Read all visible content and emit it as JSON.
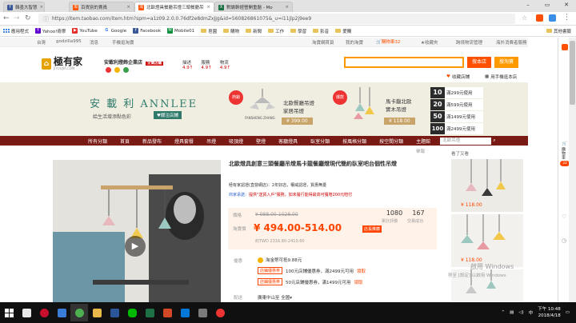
{
  "tabs": [
    {
      "label": "韓墨大智慧",
      "icon": "facebook-icon",
      "color": "#3b5998"
    },
    {
      "label": "百貨別的賣員",
      "icon": "taobao-icon",
      "color": "#ff5000"
    },
    {
      "label": "北歐燈具餐廳吊燈三頭餐廳吊燈",
      "icon": "taobao-icon",
      "color": "#ff5000"
    },
    {
      "label": "對論幹經營開重題 - Mo",
      "icon": "excel-icon",
      "color": "#1e7145"
    }
  ],
  "address": {
    "url": "https://item.taobao.com/item.htm?spm=a1z09.2.0.0.76df2e8dmZxJjg&id=560826861075&_u=i11jlp2j9ee9"
  },
  "bookmarks": [
    {
      "label": "應用程式",
      "icon": "apps-icon"
    },
    {
      "label": "Yahoo!奇摩",
      "icon": "yahoo-icon"
    },
    {
      "label": "YouTube",
      "icon": "youtube-icon"
    },
    {
      "label": "Google",
      "icon": "google-icon"
    },
    {
      "label": "Facebook",
      "icon": "facebook-icon"
    },
    {
      "label": "Mobile01",
      "icon": "mobile01-icon"
    },
    {
      "label": "皂園",
      "icon": "folder-icon"
    },
    {
      "label": "購物",
      "icon": "folder-icon"
    },
    {
      "label": "新聞",
      "icon": "folder-icon"
    },
    {
      "label": "工作",
      "icon": "folder-icon"
    },
    {
      "label": "學習",
      "icon": "folder-icon"
    },
    {
      "label": "影音",
      "icon": "folder-icon"
    },
    {
      "label": "愛購",
      "icon": "folder-icon"
    }
  ],
  "bookmarks_other": "其他書籤",
  "tb_top": {
    "region": "台灣",
    "user": "godzilla995",
    "msg": "消息",
    "mobile": "手機逛淘寶",
    "links": [
      "淘寶網首頁",
      "我的淘寶",
      "購物車32",
      "收藏夾",
      "商品分類",
      "免費開店",
      "賣家中心",
      "聯繫客服",
      "網站導航"
    ],
    "cart": "購物車32",
    "fav": "收藏夾",
    "seller": "跨境物流管理",
    "extra": "海外消費者服務"
  },
  "shop": {
    "logo": "極有家",
    "logo_sub": "JIYOUJIA.COM",
    "name": "安載利燈飾企業店",
    "badge": "企業店鋪",
    "ratings": [
      {
        "label": "描述",
        "value": "4.9"
      },
      {
        "label": "服務",
        "value": "4.9"
      },
      {
        "label": "物流",
        "value": "4.9"
      }
    ],
    "search_btn1": "搜本店",
    "search_btn2": "搜淘寶",
    "hot": "收藏店鋪",
    "mobile_shop": "用手機逛本店"
  },
  "banner": {
    "brand": "安 載 利 ANNLEE",
    "slogan": "給生活增添點色彩",
    "follow": "♥關注店鋪",
    "promo1": {
      "tag": "熱銷",
      "title": "北歐餐廳吊燈",
      "sub": "家居吊燈",
      "price": "¥ 399.00",
      "brandname": "FANSHENG ZHANG"
    },
    "promo2": {
      "tag": "爆款",
      "title": "馬卡龍北歐",
      "sub": "實木吊燈",
      "price": "¥ 118.00"
    },
    "coupons": [
      {
        "amount": "10",
        "desc": "滿299元使用"
      },
      {
        "amount": "20",
        "desc": "滿599元使用"
      },
      {
        "amount": "50",
        "desc": "滿1499元使用"
      },
      {
        "amount": "100",
        "desc": "滿2499元使用"
      }
    ]
  },
  "nav": [
    "所有分類",
    "首頁",
    "新品發布",
    "燈具套餐",
    "吊燈",
    "吸頂燈",
    "壁燈",
    "落地燈",
    "客廳燈具",
    "臥室分類",
    "客廳吊燈",
    "按風格分類",
    "按空間分類",
    "主題館"
  ],
  "nav_search_placeholder": "北歐吊燈",
  "product": {
    "title": "北歐燈具創意三頭餐廳吊燈馬卡龍餐廳燈現代簡約臥室吧台個性吊燈",
    "report": "舉報",
    "promo_line": "極有家認證(直營網店)：2年好店，權威認證，質惠無憂",
    "notice_label": "商家承諾：",
    "notice": "提供\"送貨入戶\"服務，如未履行能得最高可獲賠200元賠付",
    "price_label": "價格",
    "orig_price": "¥ 988.00-1028.00",
    "promo_label": "淘寶價",
    "price": "¥ 494.00-514.00",
    "price_tag": "店長推薦",
    "twd": "約TWD 2316.80-2410.60",
    "sales": {
      "count": "1080",
      "label": "累計評價"
    },
    "trade": {
      "count": "167",
      "label": "交易成功"
    },
    "coupon_label": "優惠",
    "coupon_line": "淘金幣可抵9.88元",
    "coupons": [
      {
        "tag": "店鋪優惠券",
        "text": "100元店鋪優惠券，滿2499元可用",
        "get": "領取"
      },
      {
        "tag": "店鋪優惠券",
        "text": "50元店鋪優惠券，滿1499元可用",
        "get": "領取"
      }
    ],
    "ship_label": "配送",
    "ship": "廣東中山至 全國"
  },
  "related": {
    "label": "看了又看",
    "items": [
      {
        "price": "¥ 118.00"
      },
      {
        "price": "¥ 118.00"
      },
      {
        "price": "¥ 118.00"
      }
    ]
  },
  "watermark": {
    "line1": "啟用 Windows",
    "line2": "移至 [設定] 以啟用 Windows"
  },
  "sidebar": {
    "label": "購物車",
    "count": "32"
  },
  "taskbar": {
    "time": "下午 10:48",
    "date": "2018/4/18"
  },
  "colors": {
    "taobao_orange": "#ff5000",
    "nav_red": "#7a1a14",
    "price_red": "#f40",
    "search_orange": "#ff9900"
  }
}
